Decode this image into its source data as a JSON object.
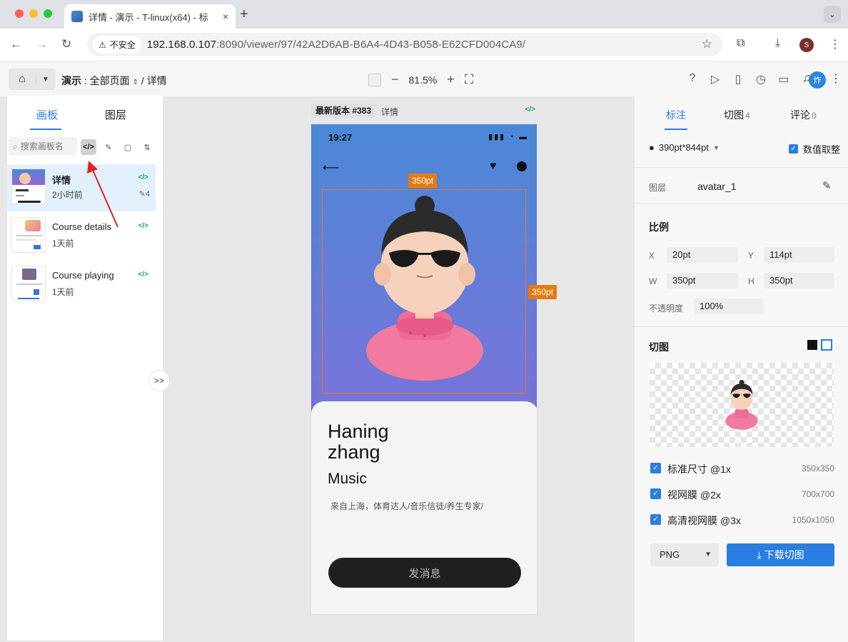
{
  "browser": {
    "tab_title": "详情 - 演示 - T-linux(x64) - 标",
    "tab_close": "×",
    "new_tab": "+",
    "insecure_label": "不安全",
    "url_host": "192.168.0.107",
    "url_path": ":8090/viewer/97/42A2D6AB-B6A4-4D43-B058-E62CFD004CA9/",
    "profile_initial": "S"
  },
  "app": {
    "breadcrumb_project": "演示",
    "breadcrumb_sep1": " : ",
    "breadcrumb_pages": "全部页面",
    "breadcrumb_sep2": " / ",
    "breadcrumb_page": "详情",
    "zoom": "81.5%",
    "user_avatar": "炸"
  },
  "left_panel": {
    "tabs": [
      "画板",
      "图层"
    ],
    "search_placeholder": "搜索画板名",
    "boards": [
      {
        "name": "详情",
        "time": "2小时前",
        "code": "</>",
        "edits": "4"
      },
      {
        "name": "Course details",
        "time": "1天前",
        "code": "</>"
      },
      {
        "name": "Course playing",
        "time": "1天前",
        "code": "</>"
      }
    ]
  },
  "canvas": {
    "version_label": "最新版本 #383",
    "page_label": "详情",
    "code_tag": "</>",
    "width_tag": "350pt",
    "height_tag": "350pt",
    "phone": {
      "status_time": "19:27",
      "name": "Haning\nzhang",
      "name_line1": "Haning",
      "name_line2": "zhang",
      "role": "Music",
      "bio": "来自上海，体育达人/音乐信徒/养生专家/",
      "button": "发消息"
    }
  },
  "right_panel": {
    "tabs": [
      {
        "label": "标注",
        "count": ""
      },
      {
        "label": "切图",
        "count": "4"
      },
      {
        "label": "评论",
        "count": "0"
      }
    ],
    "device": "390pt*844pt",
    "round_values_label": "数值取整",
    "layer_label": "图层",
    "layer_name": "avatar_1",
    "ratio_label": "比例",
    "x_label": "X",
    "x_value": "20pt",
    "y_label": "Y",
    "y_value": "114pt",
    "w_label": "W",
    "w_value": "350pt",
    "h_label": "H",
    "h_value": "350pt",
    "opacity_label": "不透明度",
    "opacity_value": "100%",
    "slice_label": "切图",
    "scales": [
      {
        "name": "标准尺寸 @1x",
        "size": "350x350"
      },
      {
        "name": "视网膜 @2x",
        "size": "700x700"
      },
      {
        "name": "高清视网膜 @3x",
        "size": "1050x1050"
      }
    ],
    "format": "PNG",
    "download_label": "下载切图"
  }
}
